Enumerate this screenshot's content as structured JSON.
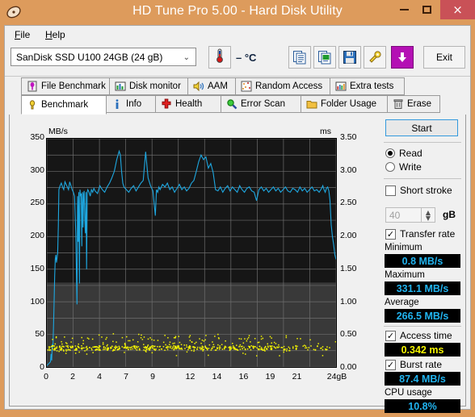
{
  "window": {
    "title": "HD Tune Pro 5.00 - Hard Disk Utility",
    "app_icon": "hard-disk-icon",
    "minimize": "–",
    "maximize": "□",
    "close": "×",
    "frame_color": "#dd9b5c",
    "close_color": "#c95157"
  },
  "menu": [
    {
      "label": "File",
      "accel": "F",
      "rest": "ile"
    },
    {
      "label": "Help",
      "accel": "H",
      "rest": "elp"
    }
  ],
  "toolbar": {
    "drive": "SanDisk SSD U100 24GB (24 gB)",
    "drive_chevron": "⌄",
    "temperature": "– °C",
    "temp_icon": "thermometer-icon",
    "buttons": [
      {
        "name": "copy-text-icon"
      },
      {
        "name": "copy-image-icon"
      },
      {
        "name": "save-icon"
      },
      {
        "name": "settings-icon"
      },
      {
        "name": "download-icon"
      }
    ],
    "exit_label": "Exit"
  },
  "tabs": {
    "top_row": [
      {
        "label": "File Benchmark",
        "icon": "file-benchmark-icon",
        "active": false
      },
      {
        "label": "Disk monitor",
        "icon": "disk-monitor-icon",
        "active": false
      },
      {
        "label": "AAM",
        "icon": "speaker-icon",
        "active": false
      },
      {
        "label": "Random Access",
        "icon": "random-access-icon",
        "active": false
      },
      {
        "label": "Extra tests",
        "icon": "extra-tests-icon",
        "active": false
      }
    ],
    "bottom_row": [
      {
        "label": "Benchmark",
        "icon": "benchmark-icon",
        "active": true
      },
      {
        "label": "Info",
        "icon": "info-icon",
        "active": false
      },
      {
        "label": "Health",
        "icon": "health-icon",
        "active": false
      },
      {
        "label": "Error Scan",
        "icon": "error-scan-icon",
        "active": false
      },
      {
        "label": "Folder Usage",
        "icon": "folder-usage-icon",
        "active": false
      },
      {
        "label": "Erase",
        "icon": "erase-icon",
        "active": false
      }
    ]
  },
  "sidebar": {
    "start_label": "Start",
    "mode": {
      "read_label": "Read",
      "write_label": "Write",
      "selected": "Read"
    },
    "short_stroke": {
      "label": "Short stroke",
      "checked": false,
      "value": "40",
      "unit": "gB"
    },
    "transfer_rate": {
      "label": "Transfer rate",
      "checked": true
    },
    "stats": [
      {
        "label": "Minimum",
        "value": "0.8 MB/s",
        "color": "cyan"
      },
      {
        "label": "Maximum",
        "value": "331.1 MB/s",
        "color": "cyan"
      },
      {
        "label": "Average",
        "value": "266.5 MB/s",
        "color": "cyan"
      }
    ],
    "access_time": {
      "label": "Access time",
      "checked": true,
      "value": "0.342 ms",
      "color": "yellow"
    },
    "burst_rate": {
      "label": "Burst rate",
      "checked": true,
      "value": "87.4 MB/s",
      "color": "cyan"
    },
    "cpu_usage": {
      "label": "CPU usage",
      "value": "10.8%",
      "color": "cyan"
    }
  },
  "chart_data": {
    "type": "line",
    "title": "",
    "xlabel": "",
    "ylabel": "MB/s",
    "y2label": "ms",
    "xlim": [
      0,
      24
    ],
    "ylim": [
      0,
      350
    ],
    "y2lim": [
      0,
      3.5
    ],
    "grid": true,
    "legend_position": "none",
    "xticks": [
      "0",
      "2",
      "4",
      "7",
      "9",
      "12",
      "14",
      "16",
      "19",
      "21",
      "24gB"
    ],
    "xtick_values": [
      0,
      2.2,
      4.4,
      6.6,
      8.8,
      11.9,
      14.1,
      16.3,
      18.5,
      20.7,
      24
    ],
    "yticks": [
      "0",
      "50",
      "100",
      "150",
      "200",
      "250",
      "300",
      "350"
    ],
    "y2ticks": [
      "0.00",
      "0.50",
      "1.00",
      "1.50",
      "2.00",
      "2.50",
      "3.00",
      "3.50"
    ],
    "series": [
      {
        "name": "Transfer rate",
        "color": "#1ea7e0",
        "axis": "left",
        "units": "MB/s",
        "x": [
          0.0,
          0.1,
          0.2,
          0.3,
          0.35,
          0.4,
          0.45,
          0.5,
          0.55,
          0.6,
          0.65,
          0.7,
          0.75,
          0.8,
          0.85,
          0.9,
          0.95,
          1.0,
          1.1,
          1.2,
          1.3,
          1.4,
          1.5,
          1.6,
          1.7,
          1.8,
          1.9,
          2.0,
          2.1,
          2.2,
          2.3,
          2.4,
          2.5,
          2.55,
          2.6,
          2.65,
          2.7,
          2.75,
          2.8,
          2.85,
          2.9,
          2.95,
          3.0,
          3.05,
          3.1,
          3.15,
          3.2,
          3.25,
          3.3,
          3.35,
          3.4,
          3.45,
          3.5,
          3.6,
          3.7,
          3.8,
          3.9,
          4.0,
          4.2,
          4.4,
          4.6,
          4.8,
          5.0,
          5.2,
          5.4,
          5.6,
          5.8,
          6.0,
          6.1,
          6.2,
          6.3,
          6.4,
          6.6,
          6.8,
          7.0,
          7.2,
          7.4,
          7.6,
          7.8,
          8.0,
          8.2,
          8.4,
          8.6,
          8.8,
          9.0,
          9.1,
          9.2,
          9.3,
          9.4,
          9.6,
          9.8,
          10.0,
          10.2,
          10.4,
          10.6,
          10.8,
          11.0,
          11.2,
          11.4,
          11.6,
          11.8,
          12.0,
          12.2,
          12.4,
          12.6,
          12.8,
          13.0,
          13.2,
          13.4,
          13.6,
          13.8,
          14.0,
          14.2,
          14.4,
          14.6,
          14.8,
          15.0,
          15.2,
          15.4,
          15.6,
          15.8,
          16.0,
          16.2,
          16.4,
          16.6,
          16.8,
          17.0,
          17.2,
          17.4,
          17.6,
          17.8,
          18.0,
          18.2,
          18.4,
          18.6,
          18.8,
          19.0,
          19.2,
          19.4,
          19.6,
          19.8,
          20.0,
          20.2,
          20.4,
          20.6,
          20.8,
          21.0,
          21.2,
          21.4,
          21.6,
          21.8,
          22.0,
          22.2,
          22.4,
          22.6,
          22.8,
          22.9,
          23.0,
          23.1,
          23.2,
          23.3,
          23.4,
          23.5,
          23.6,
          23.7,
          23.8,
          23.9,
          24.0
        ],
        "y": [
          2,
          4,
          6,
          8,
          20,
          10,
          35,
          30,
          60,
          95,
          140,
          165,
          172,
          160,
          168,
          175,
          215,
          272,
          278,
          282,
          276,
          272,
          284,
          280,
          276,
          272,
          284,
          278,
          272,
          268,
          262,
          205,
          96,
          262,
          192,
          268,
          128,
          272,
          262,
          266,
          185,
          268,
          214,
          265,
          270,
          225,
          205,
          268,
          150,
          268,
          272,
          270,
          268,
          262,
          272,
          268,
          274,
          270,
          266,
          278,
          272,
          268,
          276,
          282,
          290,
          300,
          318,
          331,
          325,
          300,
          282,
          276,
          272,
          268,
          274,
          278,
          270,
          276,
          282,
          286,
          330,
          290,
          278,
          270,
          232,
          272,
          268,
          276,
          272,
          280,
          276,
          282,
          272,
          276,
          268,
          274,
          280,
          272,
          276,
          270,
          274,
          282,
          286,
          300,
          315,
          325,
          318,
          322,
          305,
          312,
          298,
          272,
          270,
          276,
          268,
          274,
          278,
          270,
          276,
          272,
          268,
          278,
          272,
          268,
          274,
          276,
          270,
          268,
          255,
          272,
          276,
          270,
          274,
          268,
          272,
          276,
          270,
          274,
          268,
          272,
          276,
          270,
          268,
          274,
          272,
          268,
          276,
          270,
          274,
          268,
          272,
          276,
          270,
          272,
          268,
          274,
          278,
          272,
          268,
          274,
          276,
          270,
          255,
          218,
          200,
          188,
          172,
          165,
          150,
          205,
          245,
          268,
          272,
          278
        ]
      },
      {
        "name": "Access time",
        "color": "#f5f500",
        "axis": "right",
        "units": "ms",
        "marker": "dot",
        "typical_range_ms": [
          0.25,
          0.48
        ],
        "mean_ms": 0.342,
        "point_count": 620,
        "description": "Scattered yellow dots clustered between roughly 0.25 and 0.48 ms across the whole span, thinning slightly after 19 gB"
      }
    ]
  }
}
